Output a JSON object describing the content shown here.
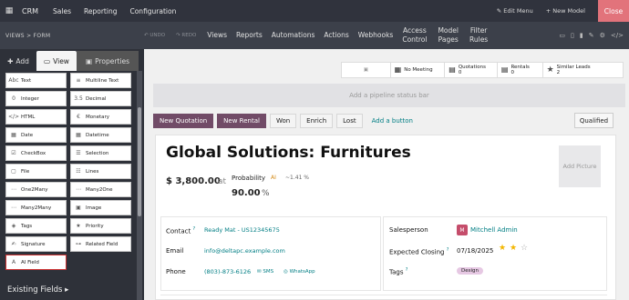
{
  "topbar": {
    "apps_icon": "grid-icon",
    "brand": "CRM",
    "menus": [
      "Sales",
      "Reporting",
      "Configuration"
    ],
    "edit_menu": "✎ Edit Menu",
    "new_model": "+ New Model",
    "close": "Close"
  },
  "toolbar": {
    "breadcrumb": "VIEWS  >  FORM",
    "undo": "↶ UNDO",
    "redo": "↷ REDO",
    "items": [
      "Views",
      "Reports",
      "Automations",
      "Actions",
      "Webhooks"
    ],
    "access_control": [
      "Access",
      "Control"
    ],
    "model_pages": [
      "Model",
      "Pages"
    ],
    "filter_rules": [
      "Filter",
      "Rules"
    ],
    "icons": [
      "desktop-icon",
      "tablet-icon",
      "phone-icon",
      "paint-icon",
      "gear-icon",
      "code-icon"
    ]
  },
  "sidebar": {
    "tabs": {
      "add": "Add",
      "view": "View",
      "properties": "Properties"
    },
    "fields": [
      [
        {
          "icon": "Abc",
          "label": "Text"
        },
        {
          "icon": "≡",
          "label": "Multiline Text"
        }
      ],
      [
        {
          "icon": "0",
          "label": "Integer"
        },
        {
          "icon": "3.5",
          "label": "Decimal"
        }
      ],
      [
        {
          "icon": "</>",
          "label": "HTML"
        },
        {
          "icon": "€",
          "label": "Monetary"
        }
      ],
      [
        {
          "icon": "▦",
          "label": "Date"
        },
        {
          "icon": "▦",
          "label": "Datetime"
        }
      ],
      [
        {
          "icon": "☑",
          "label": "CheckBox"
        },
        {
          "icon": "☰",
          "label": "Selection"
        }
      ],
      [
        {
          "icon": "▢",
          "label": "File"
        },
        {
          "icon": "☷",
          "label": "Lines"
        }
      ],
      [
        {
          "icon": "⋯",
          "label": "One2Many"
        },
        {
          "icon": "⋯",
          "label": "Many2One"
        }
      ],
      [
        {
          "icon": "⋯",
          "label": "Many2Many"
        },
        {
          "icon": "▣",
          "label": "Image"
        }
      ],
      [
        {
          "icon": "◈",
          "label": "Tags"
        },
        {
          "icon": "★",
          "label": "Priority"
        }
      ],
      [
        {
          "icon": "✍",
          "label": "Signature"
        },
        {
          "icon": "⊶",
          "label": "Related Field"
        }
      ],
      [
        {
          "icon": "A",
          "label": "AI Field"
        }
      ]
    ],
    "existing_fields": "Existing Fields ▸"
  },
  "buttonbox": {
    "meeting": "No Meeting",
    "quotations_label": "Quotations",
    "quotations_count": "0",
    "rentals_label": "Rentals",
    "rentals_count": "0",
    "similar_label": "Similar Leads",
    "similar_count": "2"
  },
  "statusbar": "Add a pipeline status bar",
  "actions": {
    "new_quotation": "New Quotation",
    "new_rental": "New Rental",
    "won": "Won",
    "enrich": "Enrich",
    "lost": "Lost",
    "add_button": "Add a button",
    "qualified": "Qualified"
  },
  "lead": {
    "title": "Global Solutions: Furnitures",
    "revenue": "$ 3,800.00",
    "at": "at",
    "probability_label": "Probability",
    "ai_badge": "AI",
    "probability_delta": "~1.41 %",
    "probability": "90.00",
    "percent": "%",
    "picture": "Add Picture"
  },
  "details_left": {
    "contact_label": "Contact",
    "contact_value": "Ready Mat - US12345675",
    "email_label": "Email",
    "email_value": "info@deltapc.example.com",
    "phone_label": "Phone",
    "phone_value": "(803)-873-6126",
    "sms": "SMS",
    "whatsapp": "WhatsApp"
  },
  "details_right": {
    "salesperson_label": "Salesperson",
    "salesperson_value": "Mitchell Admin",
    "closing_label": "Expected Closing",
    "closing_value": "07/18/2025",
    "priority_stars": 2,
    "tags_label": "Tags",
    "tag_value": "Design"
  }
}
